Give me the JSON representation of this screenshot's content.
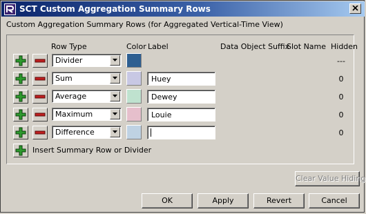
{
  "window": {
    "title": "SCT Custom Aggregation Summary Rows"
  },
  "heading": "Custom Aggregation Summary Rows (for Aggregated Vertical-Time View)",
  "columns": {
    "row_type": "Row Type",
    "color": "Color",
    "label": "Label",
    "data_object_suffix": "Data Object Suffix",
    "slot_name": "Slot Name",
    "hidden": "Hidden"
  },
  "rows": [
    {
      "row_type": "Divider",
      "color": "#2e5f91",
      "label": "",
      "hidden": "---"
    },
    {
      "row_type": "Sum",
      "color": "#c8c8e4",
      "label": "Huey",
      "hidden": "0"
    },
    {
      "row_type": "Average",
      "color": "#bfe2cf",
      "label": "Dewey",
      "hidden": "0"
    },
    {
      "row_type": "Maximum",
      "color": "#e6bfcc",
      "label": "Louie",
      "hidden": "0"
    },
    {
      "row_type": "Difference",
      "color": "#bfd2e3",
      "label": "",
      "hidden": "0"
    }
  ],
  "insert_label": "Insert Summary Row or Divider",
  "buttons": {
    "clear_value_hiding": "Clear Value Hiding",
    "ok": "OK",
    "apply": "Apply",
    "revert": "Revert",
    "cancel": "Cancel"
  },
  "icons": {
    "add": "plus-icon",
    "remove": "minus-icon",
    "dropdown": "chevron-down-icon",
    "close": "close-icon",
    "app": "app-logo-icon"
  },
  "colors": {
    "plus_green": "#2e9a2e",
    "minus_red": "#c02020",
    "titlebar": "#0a246a"
  }
}
